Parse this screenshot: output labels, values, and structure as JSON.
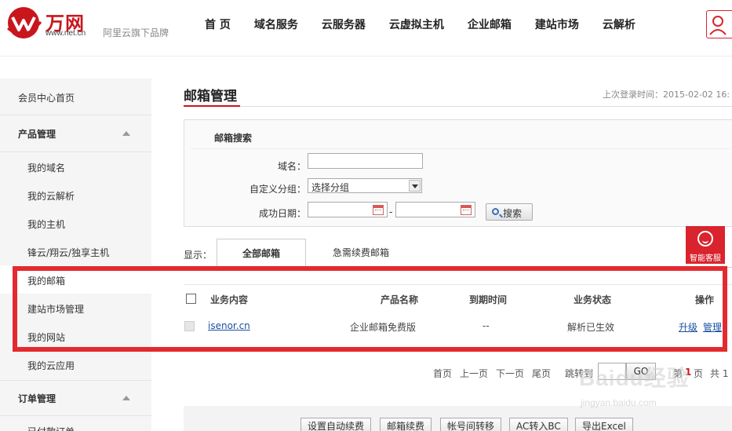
{
  "header": {
    "logo_text": "万网",
    "logo_url": "www.net.cn",
    "slogan": "阿里云旗下品牌",
    "nav": [
      "首 页",
      "域名服务",
      "云服务器",
      "云虚拟主机",
      "企业邮箱",
      "建站市场",
      "云解析"
    ]
  },
  "sidebar": {
    "home": "会员中心首页",
    "groups": [
      {
        "title": "产品管理",
        "items": [
          "我的域名",
          "我的云解析",
          "我的主机",
          "锋云/翔云/独享主机",
          "我的邮箱",
          "建站市场管理",
          "我的网站",
          "我的云应用"
        ]
      },
      {
        "title": "订单管理",
        "items": [
          "已付款订单"
        ]
      }
    ],
    "active_item": "我的邮箱"
  },
  "main": {
    "title": "邮箱管理",
    "last_login": "上次登录时间：2015-02-02 16:",
    "search": {
      "title": "邮箱搜索",
      "domain_label": "域名：",
      "domain_value": "",
      "group_label": "自定义分组：",
      "group_selected": "选择分组",
      "date_label": "成功日期：",
      "date_sep": "-",
      "button": "搜索"
    },
    "tabs": {
      "label": "显示：",
      "items": [
        "全部邮箱",
        "急需续费邮箱"
      ],
      "active": 0
    },
    "table": {
      "columns": [
        "业务内容",
        "产品名称",
        "到期时间",
        "业务状态",
        "操作"
      ],
      "rows": [
        {
          "domain": "isenor.cn",
          "product": "企业邮箱免费版",
          "expiry": "--",
          "status": "解析已生效",
          "actions": [
            "升级",
            "管理"
          ]
        }
      ]
    },
    "pager": {
      "first": "首页",
      "prev": "上一页",
      "next": "下一页",
      "last": "尾页",
      "jump": "跳转到",
      "go": "GO",
      "page_prefix": "第",
      "page_current": "1",
      "page_suffix": "页",
      "total": "共 1"
    },
    "bottom_buttons": [
      "设置自动续费",
      "邮箱续费",
      "帐号间转移",
      "AC转入BC",
      "导出Excel"
    ]
  },
  "service_badge": "智能客服",
  "watermark": {
    "text": "Baidu经验",
    "url": "jingyan.baidu.com"
  },
  "colors": {
    "brand_red": "#c8161d",
    "highlight_red": "#e32a2f",
    "link_blue": "#1a4fa0"
  }
}
